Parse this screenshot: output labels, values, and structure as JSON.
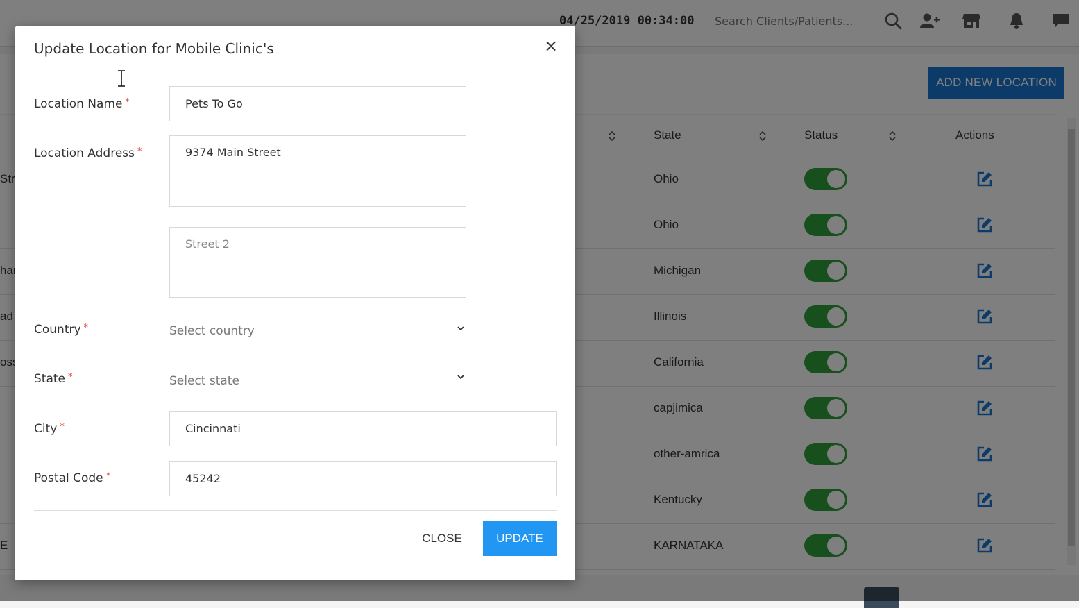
{
  "header": {
    "datetime": "04/25/2019 00:34:00",
    "search_placeholder": "Search Clients/Patients...",
    "icons": [
      "search-icon",
      "add-user-icon",
      "store-icon",
      "bell-icon",
      "chat-icon"
    ]
  },
  "page": {
    "add_button": "ADD NEW LOCATION",
    "columns": {
      "state": "State",
      "status": "Status",
      "actions": "Actions"
    },
    "rows": [
      {
        "left": "Str",
        "state": "Ohio",
        "active": true
      },
      {
        "left": "",
        "state": "Ohio",
        "active": true
      },
      {
        "left": "har",
        "state": "Michigan",
        "active": true
      },
      {
        "left": "ad",
        "state": "Illinois",
        "active": true
      },
      {
        "left": "oss",
        "state": "California",
        "active": true
      },
      {
        "left": "",
        "state": "capjimica",
        "active": true
      },
      {
        "left": "",
        "state": "other-amrica",
        "active": true
      },
      {
        "left": "",
        "state": "Kentucky",
        "active": true
      },
      {
        "left": "E",
        "state": "KARNATAKA",
        "active": true
      }
    ]
  },
  "modal": {
    "title": "Update Location for Mobile Clinic's",
    "close_symbol": "×",
    "required_mark": "*",
    "fields": {
      "location_name": {
        "label": "Location Name",
        "value": "Pets To Go"
      },
      "location_address": {
        "label": "Location Address",
        "value": "9374 Main Street"
      },
      "street2": {
        "placeholder": "Street 2",
        "value": ""
      },
      "country": {
        "label": "Country",
        "value": "Select country"
      },
      "state": {
        "label": "State",
        "value": "Select state"
      },
      "city": {
        "label": "City",
        "value": "Cincinnati"
      },
      "postal_code": {
        "label": "Postal Code",
        "value": "45242"
      }
    },
    "close_button": "CLOSE",
    "update_button": "UPDATE"
  },
  "colors": {
    "primary": "#2196f3",
    "add_button": "#1976d2",
    "toggle_on": "#2e9e3a",
    "required": "#e53935",
    "edit_icon": "#1976d2"
  }
}
